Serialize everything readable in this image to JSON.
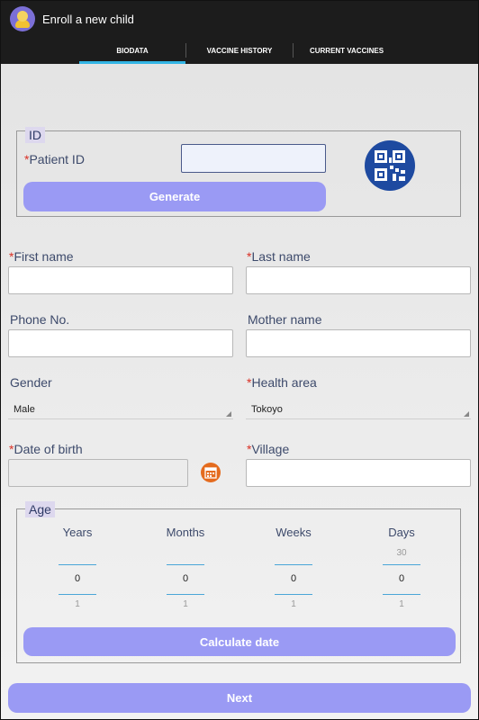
{
  "app": {
    "title": "Enroll a new child"
  },
  "tabs": [
    {
      "label": "BIODATA",
      "active": true
    },
    {
      "label": "VACCINE HISTORY",
      "active": false
    },
    {
      "label": "CURRENT VACCINES",
      "active": false
    }
  ],
  "id_section": {
    "legend": "ID",
    "required_mark": "*",
    "patient_id_label": "Patient ID",
    "patient_id_value": "",
    "generate_label": "Generate",
    "qr_icon": "qr-code-icon"
  },
  "form": {
    "required_mark": "*",
    "first_name_label": "First name",
    "last_name_label": "Last name",
    "phone_label": "Phone No.",
    "mother_label": "Mother name",
    "gender_label": "Gender",
    "gender_value": "Male",
    "health_area_label": "Health area",
    "health_area_value": "Tokoyo",
    "dob_label": "Date of birth",
    "village_label": "Village",
    "calendar_icon": "calendar-icon"
  },
  "age": {
    "legend": "Age",
    "columns": [
      {
        "label": "Years",
        "prev": "",
        "value": "0",
        "next": "1"
      },
      {
        "label": "Months",
        "prev": "",
        "value": "0",
        "next": "1"
      },
      {
        "label": "Weeks",
        "prev": "",
        "value": "0",
        "next": "1"
      },
      {
        "label": "Days",
        "prev": "30",
        "value": "0",
        "next": "1"
      }
    ],
    "calculate_label": "Calculate date"
  },
  "next_label": "Next",
  "colors": {
    "accent": "#9a9af4",
    "tab_indicator": "#33b5e5",
    "required": "#d93025",
    "qr_bg": "#1e4aa0",
    "calendar_bg": "#e46b1e"
  }
}
